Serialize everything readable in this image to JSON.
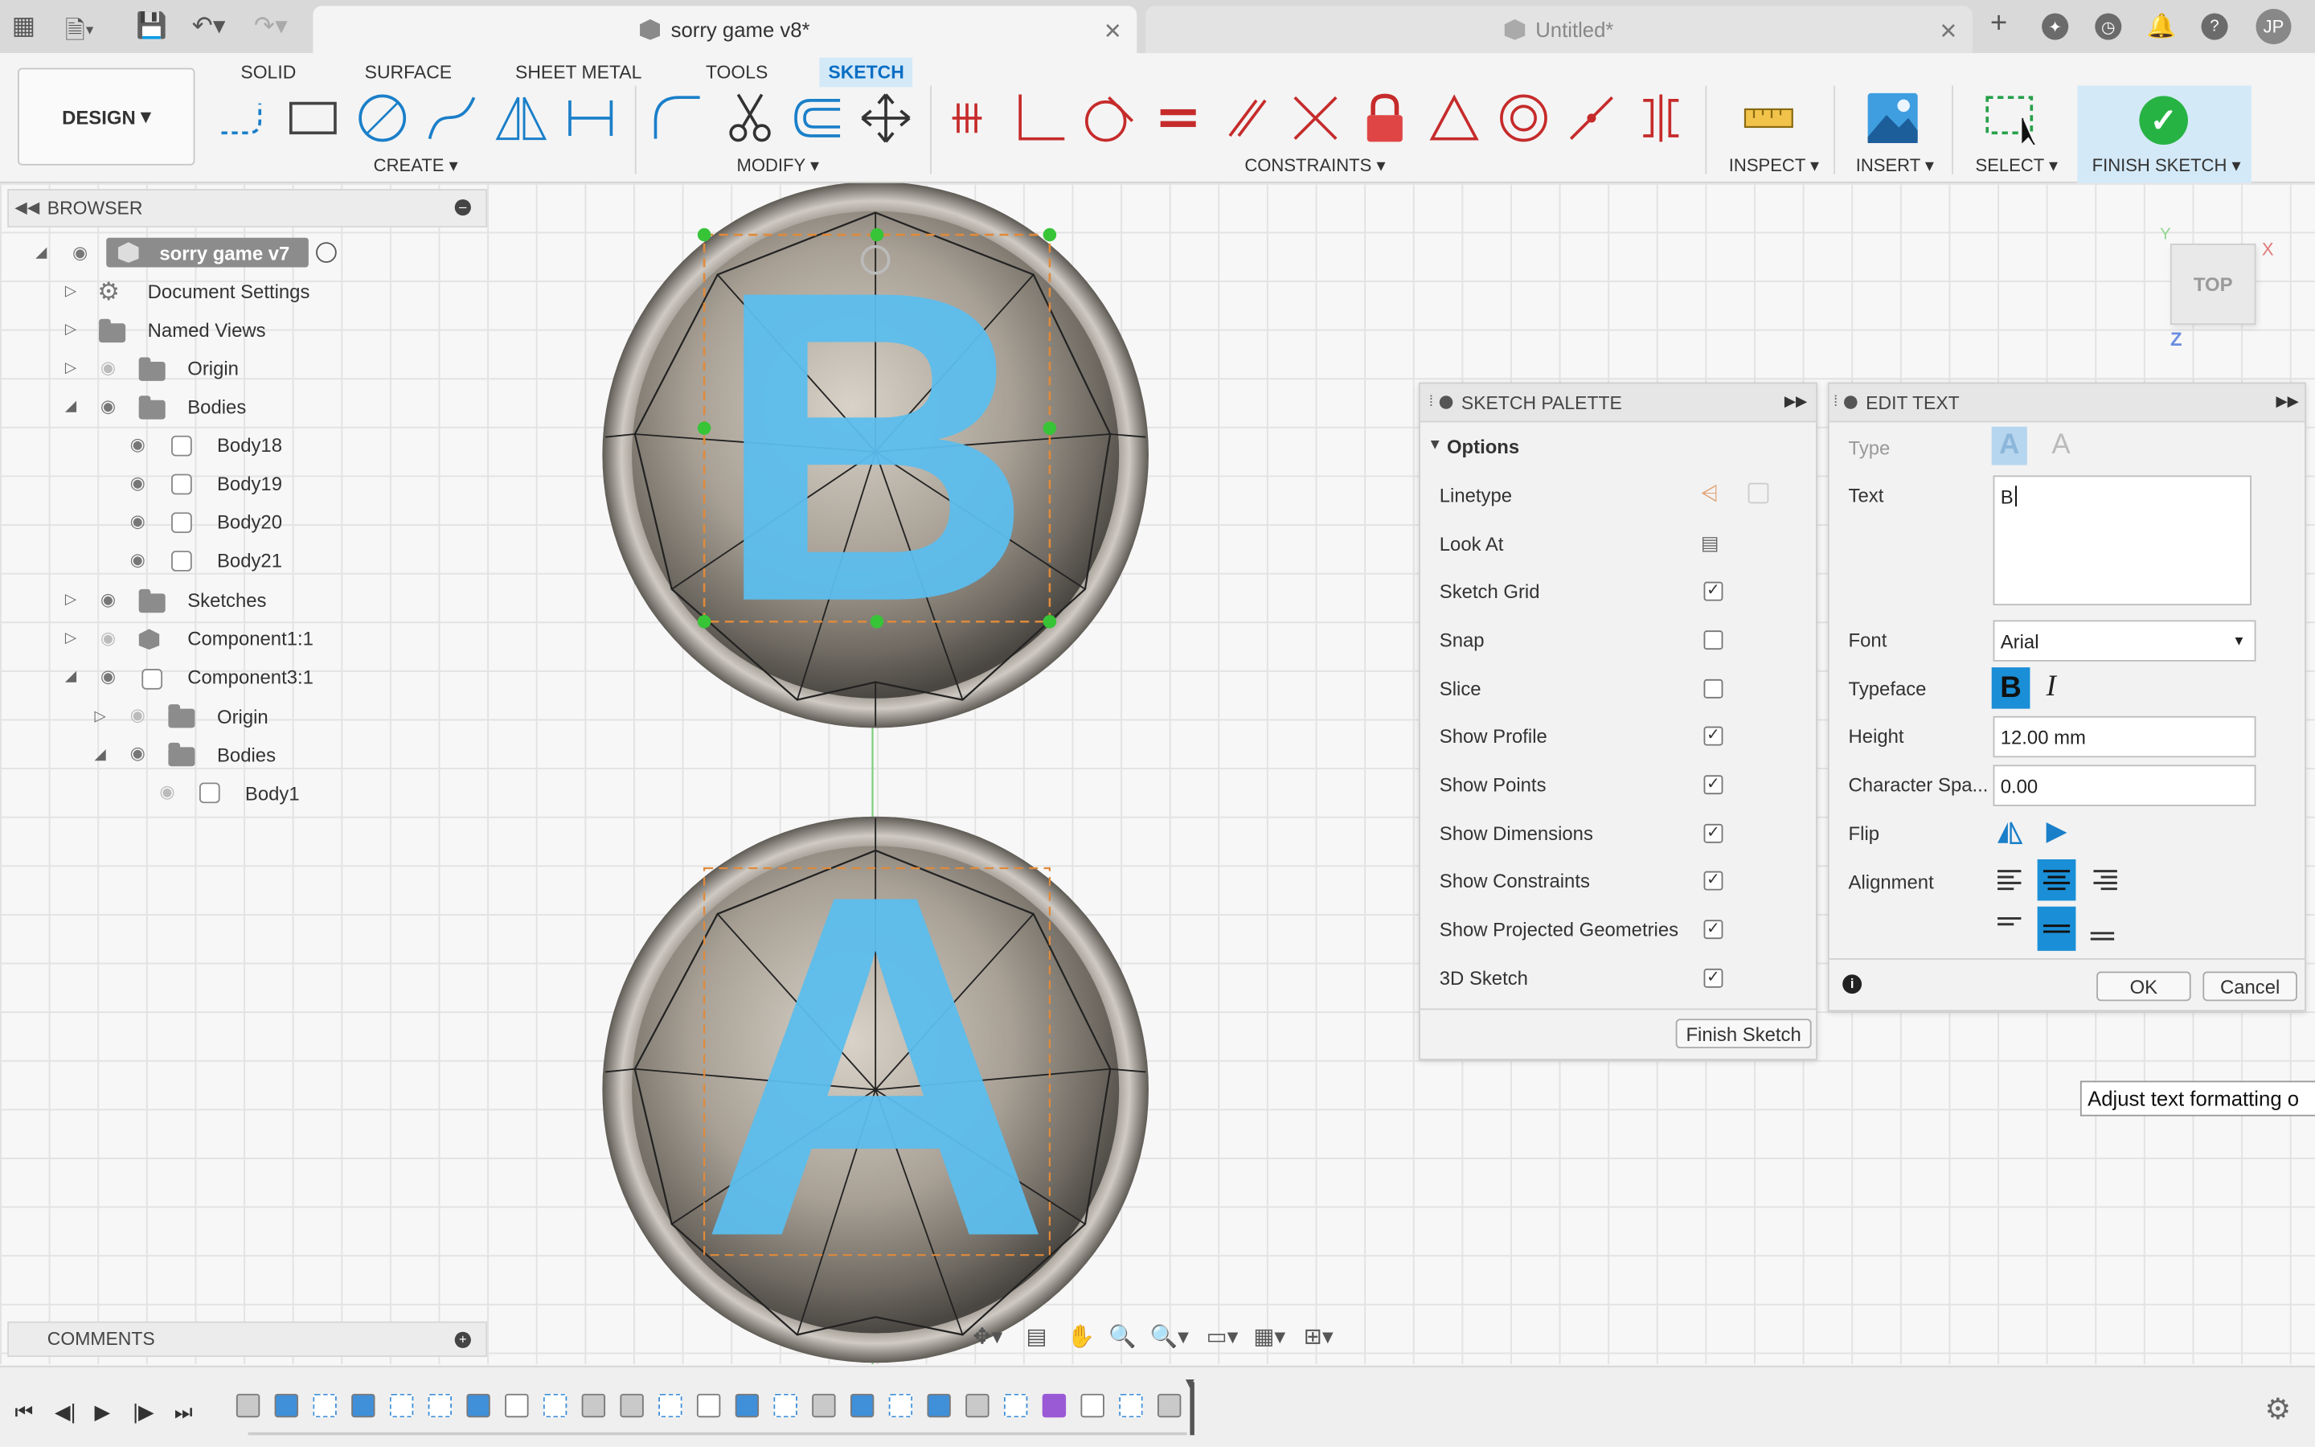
{
  "tabs": {
    "active": "sorry game v8*",
    "inactive": "Untitled*"
  },
  "user": {
    "initials": "JP"
  },
  "ribbon": {
    "workspace": "DESIGN",
    "tabs": [
      "SOLID",
      "SURFACE",
      "SHEET METAL",
      "TOOLS",
      "SKETCH"
    ],
    "active_tab": "SKETCH",
    "groups": {
      "create": "CREATE",
      "modify": "MODIFY",
      "constraints": "CONSTRAINTS",
      "inspect": "INSPECT",
      "insert": "INSERT",
      "select": "SELECT",
      "finish": "FINISH SKETCH"
    }
  },
  "browser": {
    "title": "BROWSER",
    "root": "sorry game v7",
    "items": [
      "Document Settings",
      "Named Views",
      "Origin",
      "Bodies",
      "Body18",
      "Body19",
      "Body20",
      "Body21",
      "Sketches",
      "Component1:1",
      "Component3:1",
      "Origin",
      "Bodies",
      "Body1"
    ]
  },
  "comments": {
    "title": "COMMENTS"
  },
  "canvas": {
    "letters": [
      "B",
      "A"
    ],
    "accent": "#5cbdec",
    "viewcube_label": "TOP"
  },
  "sketch_palette": {
    "title": "SKETCH PALETTE",
    "section": "Options",
    "options": [
      {
        "label": "Linetype",
        "kind": "icon"
      },
      {
        "label": "Look At",
        "kind": "icon"
      },
      {
        "label": "Sketch Grid",
        "checked": true
      },
      {
        "label": "Snap",
        "checked": false
      },
      {
        "label": "Slice",
        "checked": false
      },
      {
        "label": "Show Profile",
        "checked": true
      },
      {
        "label": "Show Points",
        "checked": true
      },
      {
        "label": "Show Dimensions",
        "checked": true
      },
      {
        "label": "Show Constraints",
        "checked": true
      },
      {
        "label": "Show Projected Geometries",
        "checked": true
      },
      {
        "label": "3D Sketch",
        "checked": true
      }
    ],
    "finish_button": "Finish Sketch"
  },
  "edit_text": {
    "title": "EDIT TEXT",
    "type_label": "Type",
    "text_label": "Text",
    "text_value": "B",
    "font_label": "Font",
    "font_value": "Arial",
    "typeface_label": "Typeface",
    "height_label": "Height",
    "height_value": "12.00 mm",
    "char_spacing_label": "Character Spa...",
    "char_spacing_value": "0.00",
    "flip_label": "Flip",
    "alignment_label": "Alignment",
    "ok": "OK",
    "cancel": "Cancel"
  },
  "tooltip": "Adjust text formatting o",
  "timeline": {
    "feature_count": 25
  }
}
